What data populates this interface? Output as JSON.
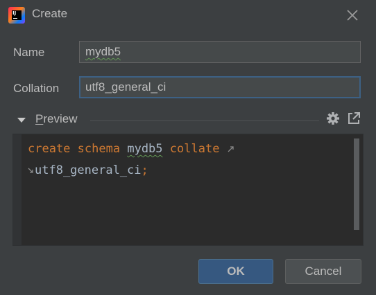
{
  "window": {
    "title": "Create",
    "app_icon_text": "IJ"
  },
  "form": {
    "name_label": "Name",
    "name_value": "mydb5",
    "collation_label": "Collation",
    "collation_value": "utf8_general_ci"
  },
  "preview": {
    "label_mnemonic": "P",
    "label_rest": "review",
    "code": {
      "line1": [
        "create",
        "schema",
        "mydb5",
        "collate"
      ],
      "line2": [
        "utf8_general_ci",
        ";"
      ]
    }
  },
  "buttons": {
    "ok_label": "OK",
    "cancel_label": "Cancel"
  },
  "colors": {
    "background": "#3c3f41",
    "editor_background": "#2b2b2b",
    "keyword": "#cc7832",
    "identifier": "#a9b7c6",
    "focus_border": "#3d6185",
    "ok_button": "#365880"
  },
  "icons": {
    "settings": "gear-icon",
    "open_in_editor": "external-link-icon",
    "collapse": "triangle-down-icon",
    "close": "close-icon"
  }
}
